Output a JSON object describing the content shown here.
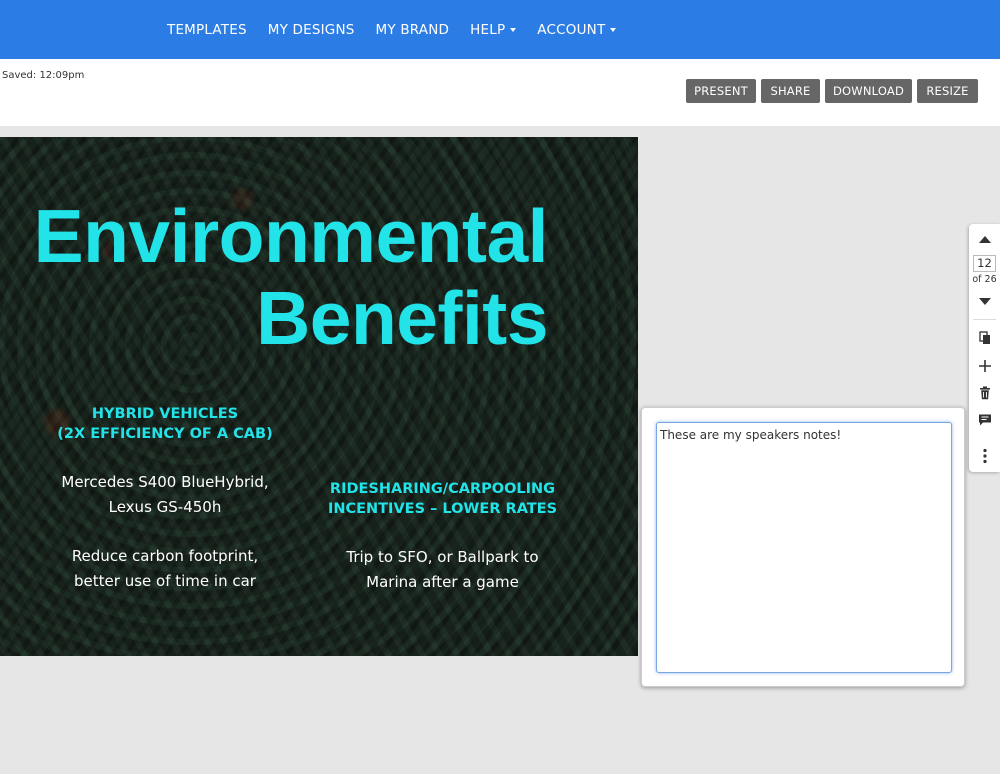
{
  "nav": {
    "items": [
      {
        "label": "TEMPLATES",
        "has_caret": false
      },
      {
        "label": "MY DESIGNS",
        "has_caret": false
      },
      {
        "label": "MY BRAND",
        "has_caret": false
      },
      {
        "label": "HELP",
        "has_caret": true
      },
      {
        "label": "ACCOUNT",
        "has_caret": true
      }
    ]
  },
  "toolbar": {
    "saved_text": "Saved: 12:09pm",
    "present_label": "PRESENT",
    "share_label": "SHARE",
    "download_label": "DOWNLOAD",
    "resize_label": "RESIZE"
  },
  "slide": {
    "title_line1": "Environmental",
    "title_line2": "Benefits",
    "left_heading_line1": "HYBRID VEHICLES",
    "left_heading_line2": "(2X EFFICIENCY OF A CAB)",
    "left_body1_line1": "Mercedes S400 BlueHybrid,",
    "left_body1_line2": "Lexus GS-450h",
    "left_body2_line1": "Reduce carbon footprint,",
    "left_body2_line2": "better use of time in car",
    "right_heading_line1": "RIDESHARING/CARPOOLING",
    "right_heading_line2": "INCENTIVES – LOWER RATES",
    "right_body_line1": "Trip to SFO, or Ballpark to",
    "right_body_line2": "Marina after a game"
  },
  "pager": {
    "current_page": "12",
    "of_text": "of 26"
  },
  "notes": {
    "value": "These are my speakers notes!"
  },
  "colors": {
    "topbar": "#2b7de5",
    "button": "#666666",
    "title_accent": "#22e3e8"
  }
}
